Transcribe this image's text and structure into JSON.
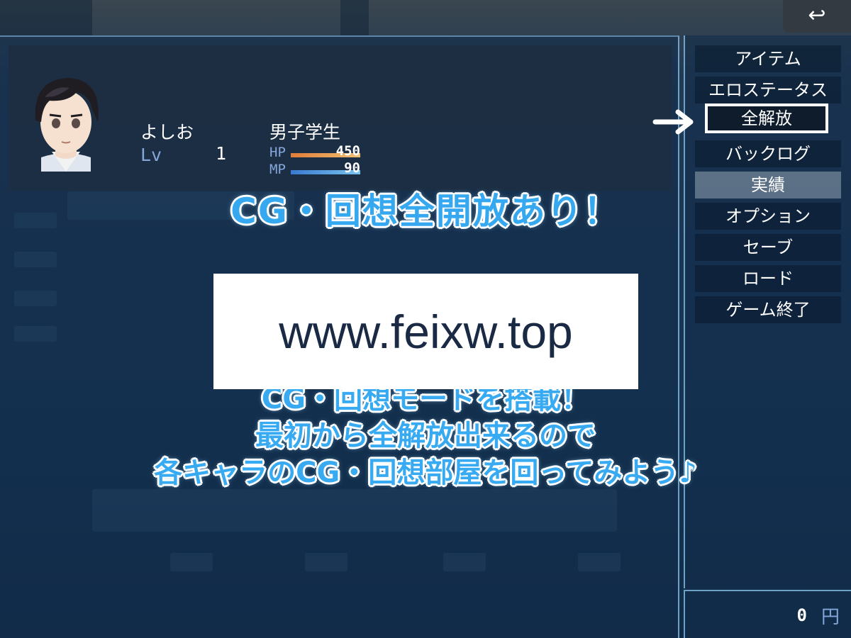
{
  "actor": {
    "name": "よしお",
    "class": "男子学生",
    "level_label": "Lv",
    "level": "1",
    "hp_label": "HP",
    "hp": "450",
    "mp_label": "MP",
    "mp": "90",
    "hp_ratio": 1.0,
    "mp_ratio": 1.0
  },
  "menu": {
    "items": [
      {
        "label": "アイテム"
      },
      {
        "label": "エロステータス"
      },
      {
        "label": "全解放"
      },
      {
        "label": "バックログ"
      },
      {
        "label": "実績"
      },
      {
        "label": "オプション"
      },
      {
        "label": "セーブ"
      },
      {
        "label": "ロード"
      },
      {
        "label": "ゲーム終了"
      }
    ]
  },
  "back_button": {
    "icon": "return-arrow-icon",
    "glyph": "↩"
  },
  "gold": {
    "value": "0",
    "unit": "円"
  },
  "overlay": {
    "headline": "CG・回想全開放あり！",
    "caption_lines": [
      "CG・回想モードを搭載！",
      "最初から全解放出来るので",
      "各キャラのCG・回想部屋を回ってみよう♪"
    ]
  },
  "watermark": {
    "text": "www.feixw.top"
  },
  "colors": {
    "caption_blue": "#38aaf2",
    "hp_gauge": "#e07c3a",
    "mp_gauge": "#3a7ad0"
  }
}
